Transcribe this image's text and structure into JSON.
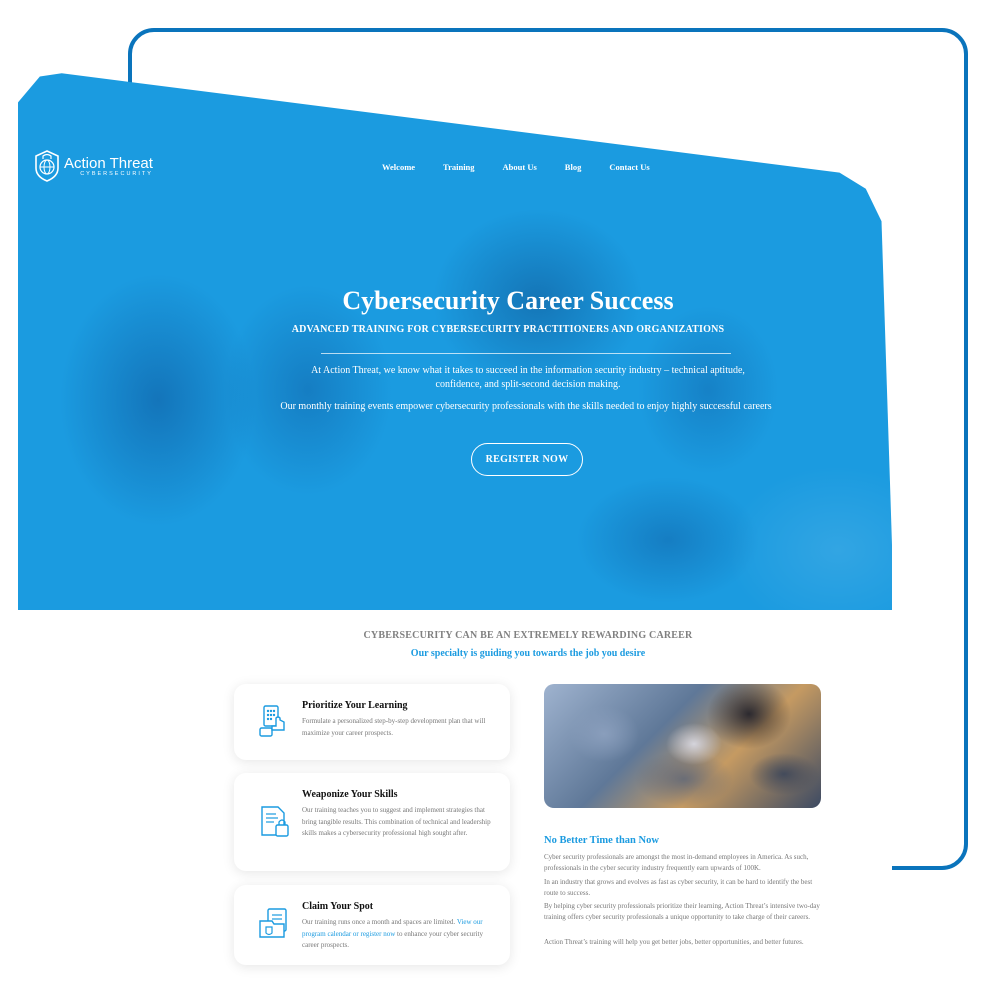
{
  "brand": {
    "name": "Action Threat",
    "tagline": "CYBERSECURITY"
  },
  "nav": {
    "items": [
      "Welcome",
      "Training",
      "About Us",
      "Blog",
      "Contact Us"
    ]
  },
  "hero": {
    "title": "Cybersecurity Career Success",
    "subtitle": "ADVANCED TRAINING FOR CYBERSECURITY PRACTITIONERS AND ORGANIZATIONS",
    "paragraph1": "At Action Threat, we know what it takes to succeed in the information security industry – technical aptitude, confidence, and split-second decision making.",
    "paragraph2": "Our monthly training events empower cybersecurity professionals with the skills needed to enjoy highly successful careers",
    "cta": "REGISTER NOW"
  },
  "career": {
    "heading": "CYBERSECURITY CAN BE AN EXTREMELY REWARDING CAREER",
    "subheading": "Our specialty is guiding you towards the job you desire"
  },
  "cards": [
    {
      "title": "Prioritize Your Learning",
      "text": "Formulate a personalized step-by-step development plan that will maximize your career prospects.",
      "icon": "keypad-icon"
    },
    {
      "title": "Weaponize Your Skills",
      "text": "Our training teaches you to suggest and implement strategies that bring tangible results. This combination of technical and leadership skills makes a cybersecurity professional high sought after.",
      "icon": "secure-document-icon"
    },
    {
      "title": "Claim Your Spot",
      "text_before": "Our training runs once a month and spaces are limited.",
      "link": "View our program calendar or register now",
      "text_after": "to enhance your cyber security career prospects.",
      "icon": "secure-files-icon"
    }
  ],
  "better_time": {
    "title": "No Better Time than Now",
    "paragraphs": [
      "Cyber security professionals are amongst the most in-demand employees in America. As such, professionals in the cyber security industry frequently earn upwards of 100K.",
      "In an industry that grows and evolves as fast as cyber security, it can be hard to identify the best route to success.",
      "By helping cyber security professionals prioritize their learning, Action Threat’s intensive two-day training offers cyber security professionals a unique opportunity to take charge of their careers.",
      "Action Threat’s training will help you get better jobs, better opportunities, and better futures."
    ]
  },
  "colors": {
    "primary": "#1b9be0",
    "frame": "#0a74bc",
    "muted_text": "#777777",
    "heading_gray": "#808080"
  }
}
